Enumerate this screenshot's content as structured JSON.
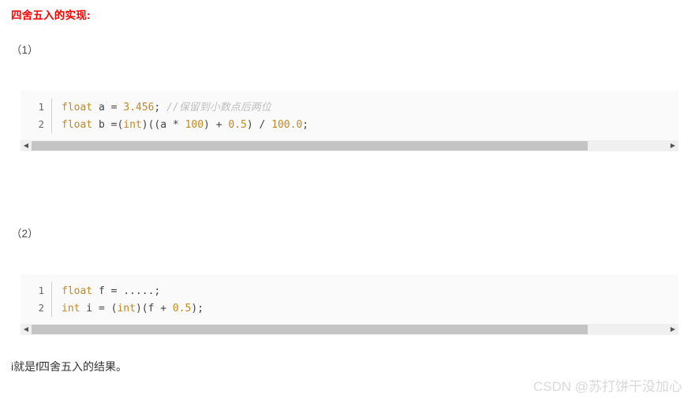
{
  "document": {
    "title": "四舍五入的实现:",
    "title_color": "#ff0000",
    "background_color": "#ffffff",
    "footer_text": "i就是f四舍五入的结果。"
  },
  "sections": [
    {
      "marker": "（1）"
    },
    {
      "marker": "（2）"
    }
  ],
  "code_blocks": [
    {
      "id": "code-block-1",
      "language": "c",
      "background": "#fafafa",
      "lines": [
        {
          "number": "1",
          "tokens": [
            {
              "text": "float",
              "type": "keyword"
            },
            {
              "text": " a ",
              "type": "plain"
            },
            {
              "text": "=",
              "type": "punct"
            },
            {
              "text": " ",
              "type": "plain"
            },
            {
              "text": "3.456",
              "type": "number"
            },
            {
              "text": "; ",
              "type": "punct"
            },
            {
              "text": "//保留到小数点后两位",
              "type": "comment"
            }
          ]
        },
        {
          "number": "2",
          "tokens": [
            {
              "text": "float",
              "type": "keyword"
            },
            {
              "text": " b ",
              "type": "plain"
            },
            {
              "text": "=(",
              "type": "punct"
            },
            {
              "text": "int",
              "type": "keyword"
            },
            {
              "text": ")((a * ",
              "type": "punct"
            },
            {
              "text": "100",
              "type": "number"
            },
            {
              "text": ") + ",
              "type": "punct"
            },
            {
              "text": "0.5",
              "type": "number"
            },
            {
              "text": ") / ",
              "type": "punct"
            },
            {
              "text": "100.0",
              "type": "number"
            },
            {
              "text": ";",
              "type": "punct"
            }
          ]
        }
      ],
      "scrollbar": {
        "left_arrow": "◀",
        "right_arrow": "▶",
        "thumb_width_percent": 87.5,
        "thumb_color": "#c4c4c4",
        "track_color": "#f0f0f0"
      }
    },
    {
      "id": "code-block-2",
      "language": "c",
      "background": "#fafafa",
      "lines": [
        {
          "number": "1",
          "tokens": [
            {
              "text": "float",
              "type": "keyword"
            },
            {
              "text": " f ",
              "type": "plain"
            },
            {
              "text": "= .....;",
              "type": "punct"
            }
          ]
        },
        {
          "number": "2",
          "tokens": [
            {
              "text": "int",
              "type": "keyword"
            },
            {
              "text": " i ",
              "type": "plain"
            },
            {
              "text": "= (",
              "type": "punct"
            },
            {
              "text": "int",
              "type": "keyword"
            },
            {
              "text": ")(f + ",
              "type": "punct"
            },
            {
              "text": "0.5",
              "type": "number"
            },
            {
              "text": ");",
              "type": "punct"
            }
          ]
        }
      ],
      "scrollbar": {
        "left_arrow": "◀",
        "right_arrow": "▶",
        "thumb_width_percent": 87.5,
        "thumb_color": "#c4c4c4",
        "track_color": "#f0f0f0"
      }
    }
  ],
  "watermark": {
    "text": "CSDN @苏打饼干没加心",
    "color": "#d9d9d9"
  }
}
